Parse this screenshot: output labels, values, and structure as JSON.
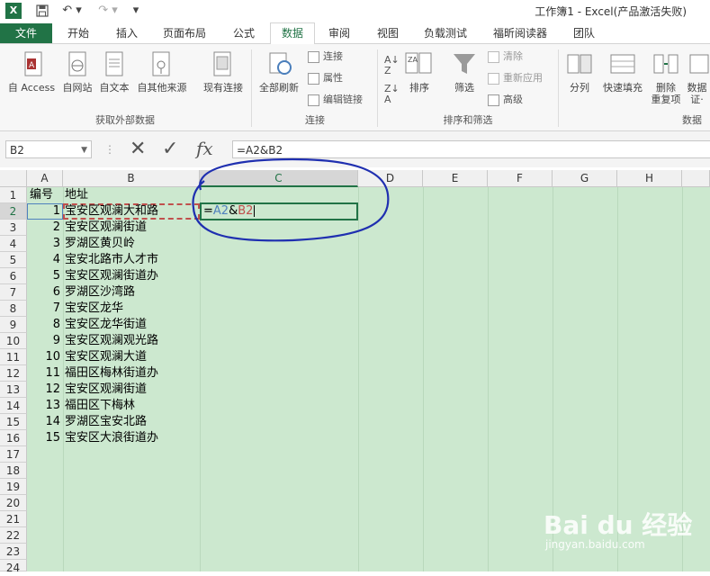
{
  "window": {
    "title": "工作簿1 - Excel(产品激活失败)"
  },
  "tabs": [
    "文件",
    "开始",
    "插入",
    "页面布局",
    "公式",
    "数据",
    "审阅",
    "视图",
    "负载测试",
    "福昕阅读器",
    "团队"
  ],
  "active_tab": "数据",
  "ribbon": {
    "get_external": {
      "buttons": [
        "自 Access",
        "自网站",
        "自文本",
        "自其他来源",
        "现有连接"
      ],
      "group_label": "获取外部数据"
    },
    "connections": {
      "refresh_all": "全部刷新",
      "small": [
        "连接",
        "属性",
        "编辑链接"
      ],
      "group_label": "连接"
    },
    "sort_filter": {
      "sort": "排序",
      "filter": "筛选",
      "small": [
        "清除",
        "重新应用",
        "高级"
      ],
      "group_label": "排序和筛选"
    },
    "data_tools": {
      "buttons": [
        "分列",
        "快速填充",
        "删除\n重复项",
        "数据\n证·"
      ],
      "group_label": "数据"
    }
  },
  "formula_bar": {
    "name_box": "B2",
    "formula": "=A2&B2"
  },
  "columns": [
    "A",
    "B",
    "C",
    "D",
    "E",
    "F",
    "G",
    "H"
  ],
  "selected_column": "C",
  "header_row": {
    "a": "编号",
    "b": "地址"
  },
  "rows": [
    {
      "a": "1",
      "b": "宝安区观澜大和路"
    },
    {
      "a": "2",
      "b": "宝安区观澜街道"
    },
    {
      "a": "3",
      "b": "罗湖区黄贝岭"
    },
    {
      "a": "4",
      "b": "宝安北路市人才市"
    },
    {
      "a": "5",
      "b": "宝安区观澜街道办"
    },
    {
      "a": "6",
      "b": "罗湖区沙湾路"
    },
    {
      "a": "7",
      "b": "宝安区龙华"
    },
    {
      "a": "8",
      "b": "宝安区龙华街道"
    },
    {
      "a": "9",
      "b": "宝安区观澜观光路"
    },
    {
      "a": "10",
      "b": "宝安区观澜大道"
    },
    {
      "a": "11",
      "b": "福田区梅林街道办"
    },
    {
      "a": "12",
      "b": "宝安区观澜街道"
    },
    {
      "a": "13",
      "b": "福田区下梅林"
    },
    {
      "a": "14",
      "b": "罗湖区宝安北路"
    },
    {
      "a": "15",
      "b": "宝安区大浪街道办"
    }
  ],
  "row_numbers": [
    "1",
    "2",
    "3",
    "4",
    "5",
    "6",
    "7",
    "8",
    "9",
    "10",
    "11",
    "12",
    "13",
    "14",
    "15",
    "16",
    "17",
    "18",
    "19",
    "20",
    "21",
    "22",
    "23",
    "24"
  ],
  "edit_cell": {
    "prefix": "=",
    "ref1": "A2",
    "amp": "&",
    "ref2": "B2"
  },
  "colors": {
    "excel_green": "#217346",
    "ref1_color": "#4f81bd",
    "ref2_color": "#c0504d",
    "annotation": "#1f2fb0",
    "sheet_bg": "#cce8cf"
  },
  "watermark": {
    "brand": "Bai du 经验",
    "url": "jingyan.baidu.com"
  }
}
